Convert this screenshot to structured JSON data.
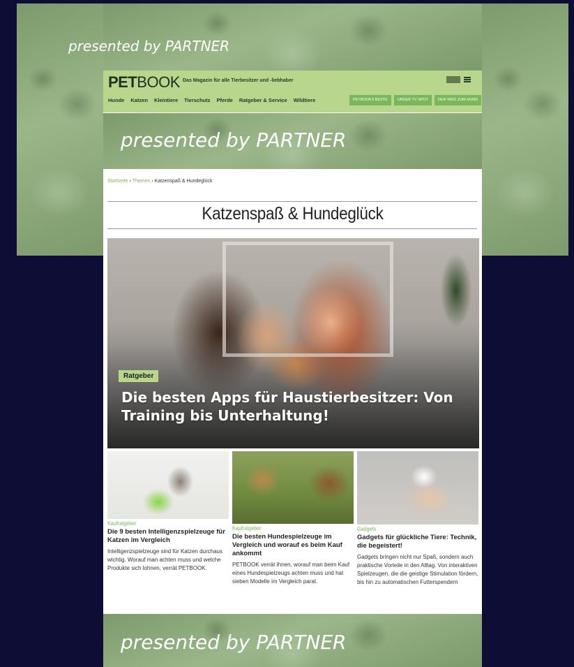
{
  "banners": {
    "presented_text": "presented by PARTNER",
    "background_color": "#8aa87a"
  },
  "header": {
    "logo_bold": "PET",
    "logo_light": "BOOK",
    "tagline": "Das Magazin für alle Tierbesitzer und -liebhaber",
    "background_color": "#b8d78c",
    "nav": [
      "Hunde",
      "Katzen",
      "Kleintiere",
      "Tierschutz",
      "Pferde",
      "Ratgeber & Service",
      "Wildtiere"
    ],
    "nav_buttons": [
      "PETBOOKS BESTE",
      "UNSER TV SPOT",
      "DER WEG ZUM HUND"
    ],
    "icons": [
      "brand-mark-icon",
      "menu-icon"
    ]
  },
  "breadcrumb": {
    "home": "Startseite",
    "separator": " › ",
    "section": "Themen",
    "current": "Katzenspaß & Hundeglück"
  },
  "page_title": "Katzenspaß & Hundeglück",
  "hero": {
    "badge": "Ratgeber",
    "title": "Die besten Apps für Haustierbesitzer: Von Training bis Unterhaltung!"
  },
  "cards": [
    {
      "category": "Kaufratgeber",
      "title": "Die 9 besten Intelligenzspielzeuge für Katzen im Vergleich",
      "text": "Intelligenzspielzeuge sind für Katzen durchaus wichtig. Worauf man achten muss und welche Produkte sich lohnen, verrät PETBOOK."
    },
    {
      "category": "Kaufratgeber",
      "title": "Die besten Hundespielzeuge im Vergleich und worauf es beim Kauf ankommt",
      "text": "PETBOOK verrät Ihnen, worauf man beim Kauf eines Hundespielzeugs achten muss und hat sieben Modelle im Vergleich parat."
    },
    {
      "category": "Gadgets",
      "title": "Gadgets für glückliche Tiere: Technik, die begeistert!",
      "text": "Gadgets bringen nicht nur Spaß, sondern auch praktische Vorteile in den Alltag. Von interaktiven Spielzeugen, die die geistige Stimulation fördern, bis hin zu automatischen Futterspendern"
    }
  ],
  "colors": {
    "page_background": "#0d0d35",
    "accent_green": "#7ab65a"
  }
}
